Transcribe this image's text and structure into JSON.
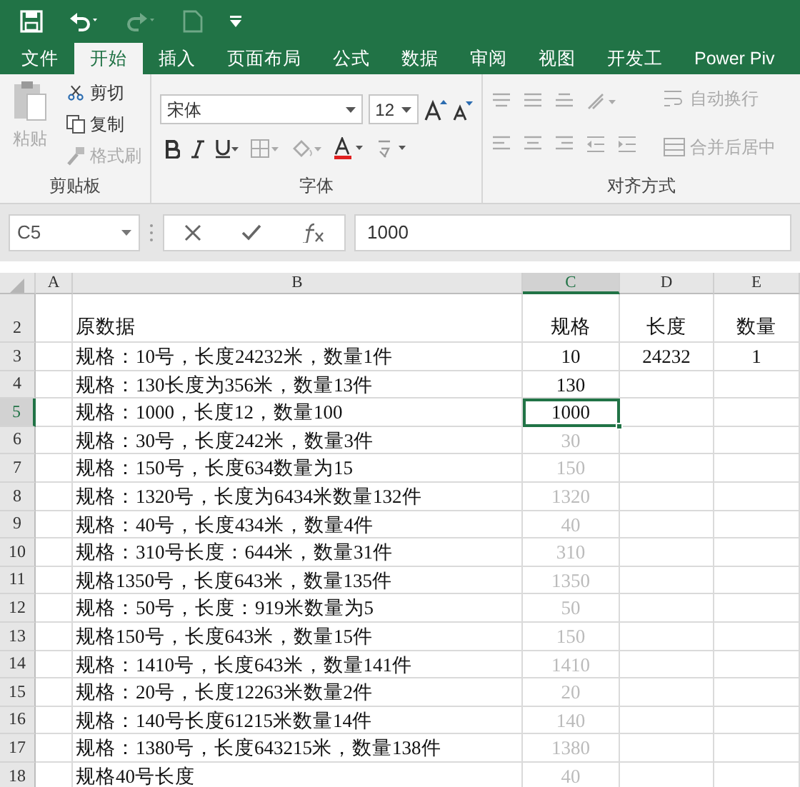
{
  "tabs": [
    {
      "label": "文件",
      "selected": false
    },
    {
      "label": "开始",
      "selected": true
    },
    {
      "label": "插入",
      "selected": false
    },
    {
      "label": "页面布局",
      "selected": false
    },
    {
      "label": "公式",
      "selected": false
    },
    {
      "label": "数据",
      "selected": false
    },
    {
      "label": "审阅",
      "selected": false
    },
    {
      "label": "视图",
      "selected": false
    },
    {
      "label": "开发工",
      "selected": false
    },
    {
      "label": "Power Piv",
      "selected": false
    }
  ],
  "clipboard": {
    "paste": "粘贴",
    "paste_disabled": true,
    "cut": "剪切",
    "copy": "复制",
    "format_painter": "格式刷",
    "format_painter_disabled": true,
    "group_label": "剪贴板"
  },
  "font": {
    "name": "宋体",
    "size": "12",
    "group_label": "字体"
  },
  "alignment": {
    "wrap_text": "自动换行",
    "merge_center": "合并后居中",
    "disabled": true,
    "group_label": "对齐方式"
  },
  "formula_bar": {
    "name_box": "C5",
    "value": "1000"
  },
  "columns": [
    {
      "label": "A",
      "selected": false
    },
    {
      "label": "B",
      "selected": false
    },
    {
      "label": "C",
      "selected": true
    },
    {
      "label": "D",
      "selected": false
    },
    {
      "label": "E",
      "selected": false
    }
  ],
  "rows": [
    {
      "number": "2",
      "selected": false,
      "source": "原数据",
      "spec": "规格",
      "spec_preview": false,
      "length": "长度",
      "quantity": "数量"
    },
    {
      "number": "3",
      "selected": false,
      "source": "规格：10号，长度24232米，数量1件",
      "spec": "10",
      "spec_preview": false,
      "length": "24232",
      "quantity": "1"
    },
    {
      "number": "4",
      "selected": false,
      "source": "规格：130长度为356米，数量13件",
      "spec": "130",
      "spec_preview": false
    },
    {
      "number": "5",
      "selected": true,
      "source": "规格：1000，长度12，数量100",
      "spec": "1000",
      "spec_preview": false
    },
    {
      "number": "6",
      "selected": false,
      "source": "规格：30号，长度242米，数量3件",
      "spec": "30",
      "spec_preview": true
    },
    {
      "number": "7",
      "selected": false,
      "source": "规格：150号，长度634数量为15",
      "spec": "150",
      "spec_preview": true
    },
    {
      "number": "8",
      "selected": false,
      "source": "规格：1320号，长度为6434米数量132件",
      "spec": "1320",
      "spec_preview": true
    },
    {
      "number": "9",
      "selected": false,
      "source": "规格：40号，长度434米，数量4件",
      "spec": "40",
      "spec_preview": true
    },
    {
      "number": "10",
      "selected": false,
      "source": "规格：310号长度：644米，数量31件",
      "spec": "310",
      "spec_preview": true
    },
    {
      "number": "11",
      "selected": false,
      "source": "规格1350号，长度643米，数量135件",
      "spec": "1350",
      "spec_preview": true
    },
    {
      "number": "12",
      "selected": false,
      "source": "规格：50号，长度：919米数量为5",
      "spec": "50",
      "spec_preview": true
    },
    {
      "number": "13",
      "selected": false,
      "source": "规格150号，长度643米，数量15件",
      "spec": "150",
      "spec_preview": true
    },
    {
      "number": "14",
      "selected": false,
      "source": "规格：1410号，长度643米，数量141件",
      "spec": "1410",
      "spec_preview": true
    },
    {
      "number": "15",
      "selected": false,
      "source": "规格：20号，长度12263米数量2件",
      "spec": "20",
      "spec_preview": true
    },
    {
      "number": "16",
      "selected": false,
      "source": "规格：140号长度61215米数量14件",
      "spec": "140",
      "spec_preview": true
    },
    {
      "number": "17",
      "selected": false,
      "source": "规格：1380号，长度643215米，数量138件",
      "spec": "1380",
      "spec_preview": true
    },
    {
      "number": "18",
      "selected": false,
      "source": "规格40号长度",
      "spec": "40",
      "spec_preview": true
    }
  ]
}
